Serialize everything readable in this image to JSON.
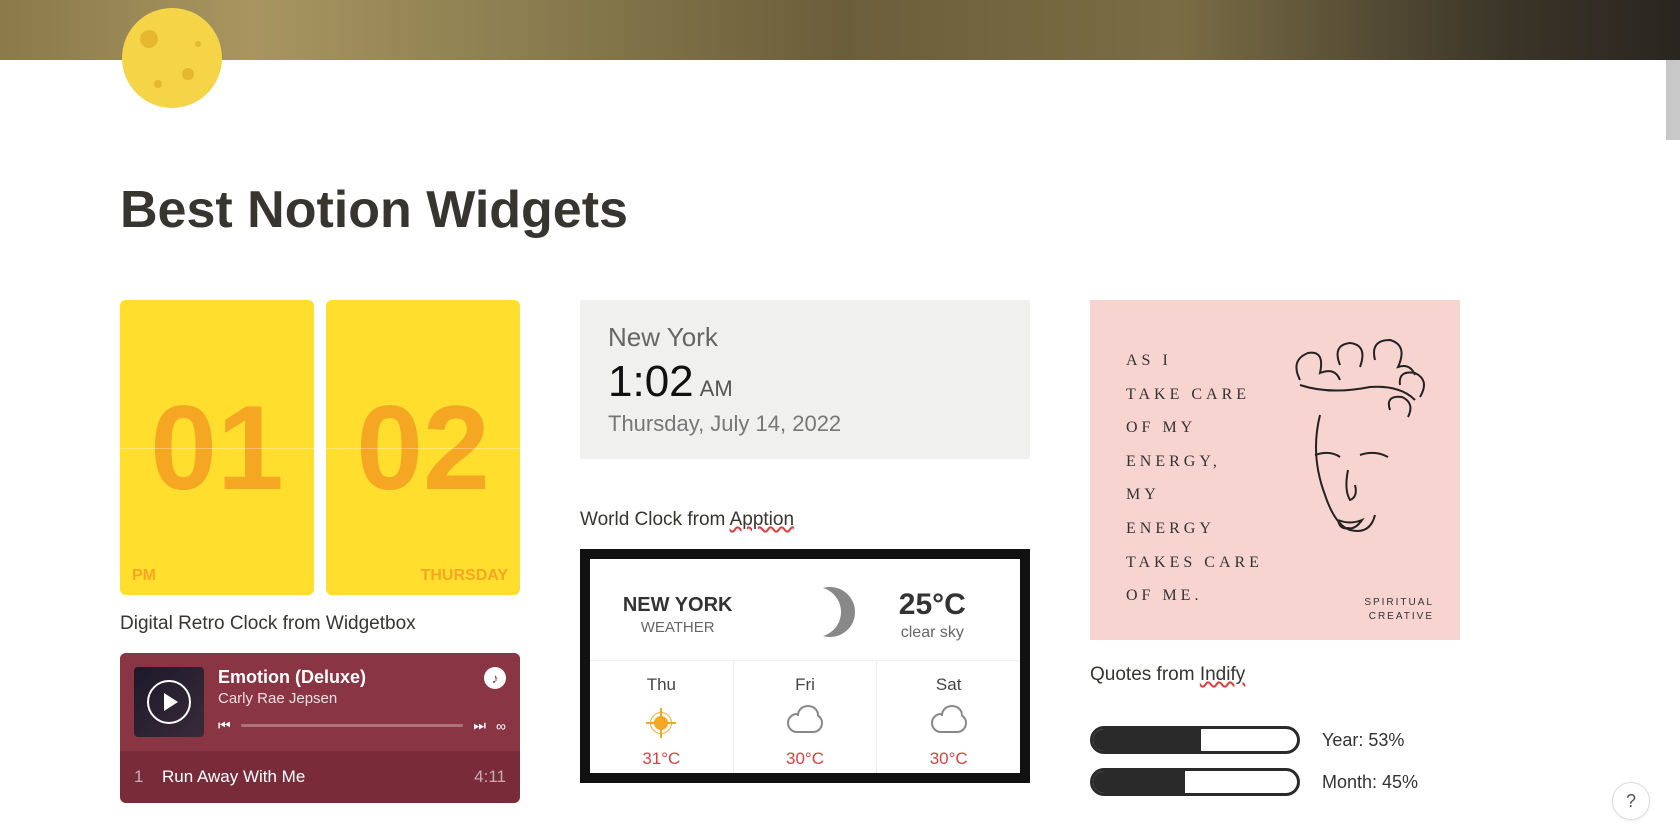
{
  "page": {
    "title": "Best Notion Widgets"
  },
  "flipclock": {
    "hour": "01",
    "minute": "02",
    "ampm": "PM",
    "day": "THURSDAY",
    "caption_prefix": "Digital Retro Clock from ",
    "caption_source": "Widgetbox"
  },
  "spotify": {
    "album": "Emotion (Deluxe)",
    "artist": "Carly Rae Jepsen",
    "track1_num": "1",
    "track1_name": "Run Away With Me",
    "track1_time": "4:11"
  },
  "worldclock": {
    "city": "New York",
    "time": "1:02",
    "ampm": "AM",
    "date": "Thursday, July 14, 2022",
    "caption_prefix": "World Clock from ",
    "caption_source": "Apption"
  },
  "weather": {
    "location": "NEW YORK",
    "label": "WEATHER",
    "temp": "25°C",
    "desc": "clear sky",
    "d1_name": "Thu",
    "d1_temp": "31°C",
    "d2_name": "Fri",
    "d2_temp": "30°C",
    "d3_name": "Sat",
    "d3_temp": "30°C"
  },
  "quote": {
    "line1": "AS I",
    "line2": "TAKE CARE",
    "line3": "OF MY",
    "line4": "ENERGY,",
    "line5": "MY",
    "line6": "ENERGY",
    "line7": "TAKES CARE",
    "line8": "OF ME.",
    "sig1": "SPIRITUAL",
    "sig2": "CREATIVE",
    "caption_prefix": "Quotes from ",
    "caption_source": "Indify"
  },
  "progress": {
    "year_label": "Year: 53%",
    "year_pct": 53,
    "month_label": "Month: 45%",
    "month_pct": 45
  },
  "help": "?"
}
